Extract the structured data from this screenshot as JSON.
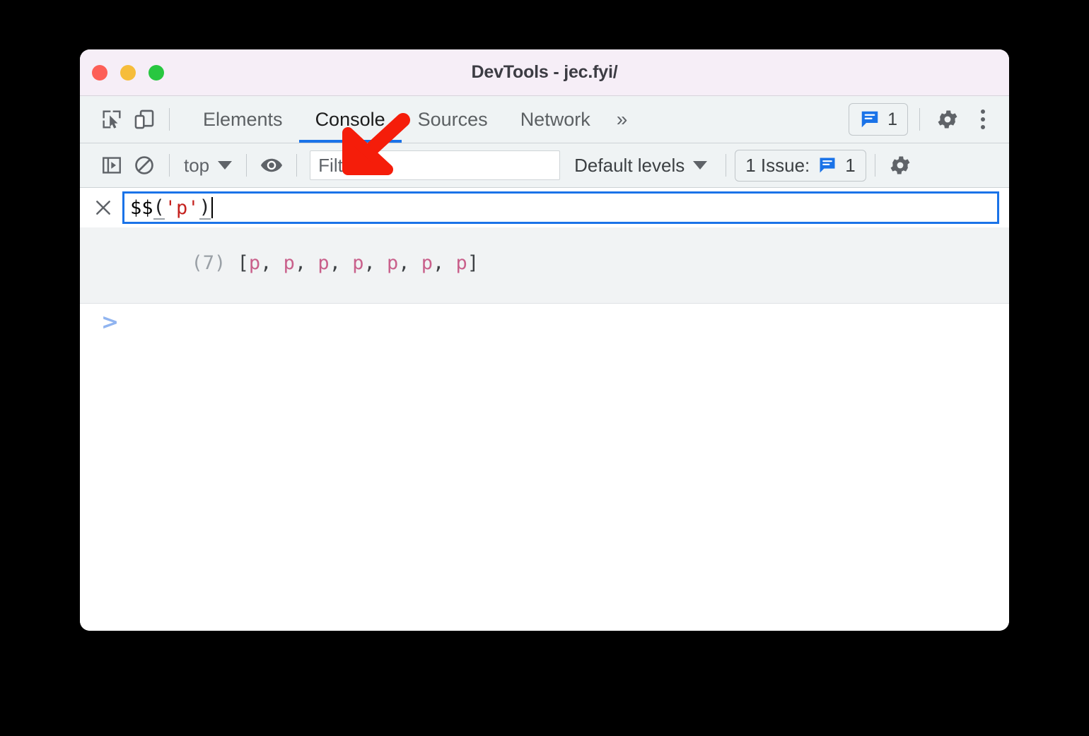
{
  "window": {
    "title": "DevTools - jec.fyi/",
    "traffic_lights": [
      "close",
      "minimize",
      "zoom"
    ]
  },
  "tabbar": {
    "inspect_icon": "inspect-element-icon",
    "device_icon": "device-toolbar-icon",
    "tabs": [
      {
        "label": "Elements",
        "active": false
      },
      {
        "label": "Console",
        "active": true
      },
      {
        "label": "Sources",
        "active": false
      },
      {
        "label": "Network",
        "active": false
      }
    ],
    "overflow_label": "»",
    "issues_badge": {
      "icon": "issues-message-icon",
      "count": "1"
    },
    "settings_icon": "gear-icon",
    "menu_icon": "kebab-menu-icon"
  },
  "console_toolbar": {
    "sidebar_icon": "console-sidebar-icon",
    "clear_icon": "clear-console-icon",
    "context": {
      "label": "top",
      "caret": "▼"
    },
    "live_expression_icon": "eye-icon",
    "filter": {
      "placeholder": "Filter",
      "value": ""
    },
    "levels": {
      "label": "Default levels",
      "caret": "▼"
    },
    "issues": {
      "label": "1 Issue:",
      "icon": "issues-message-icon",
      "count": "1"
    },
    "settings_icon": "gear-icon"
  },
  "console": {
    "close_icon": "close-icon",
    "expression": {
      "function": "$$",
      "open_paren": "(",
      "string": "'p'",
      "close_paren": ")"
    },
    "result": {
      "count": "(7)",
      "open": "[",
      "nodes": [
        "p",
        "p",
        "p",
        "p",
        "p",
        "p",
        "p"
      ],
      "separator": ", ",
      "close": "]"
    },
    "prompt": ">"
  },
  "annotation": {
    "arrow": "red-arrow-down-left",
    "color": "#f51d0a"
  },
  "colors": {
    "accent": "#1a73e8",
    "titlebar_bg": "#f6eef7",
    "toolbar_bg": "#eff3f4",
    "string_token": "#c5221f",
    "node_token": "#c9608b"
  }
}
